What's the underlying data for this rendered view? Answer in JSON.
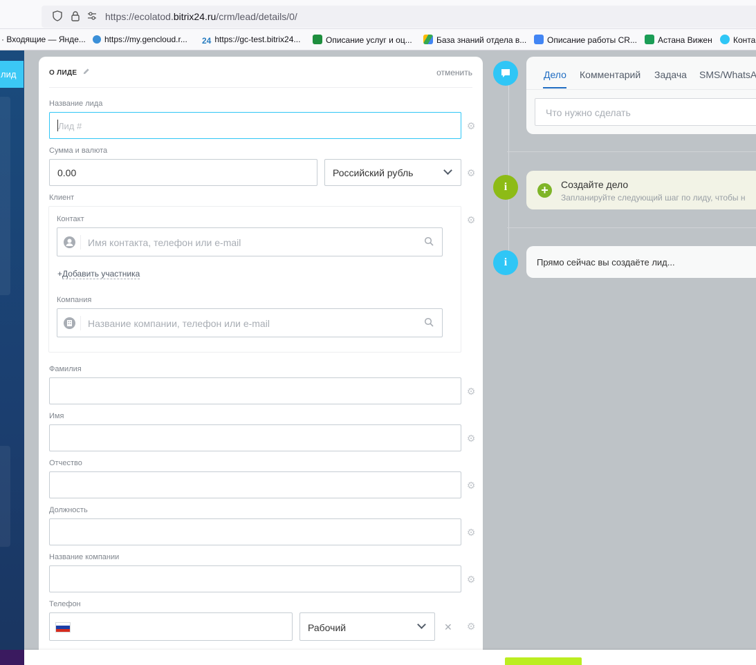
{
  "browser": {
    "url_prefix": "https://ecolatod.",
    "url_domain": "bitrix24.ru",
    "url_path": "/crm/lead/details/0/",
    "bookmarks": [
      {
        "label": "· Входящие — Яндe..."
      },
      {
        "label": "https://my.gencloud.r..."
      },
      {
        "label": "https://gc-test.bitrix24..."
      },
      {
        "label": "Описание услуг и оц..."
      },
      {
        "label": "База знаний отдела в..."
      },
      {
        "label": "Описание работы CR..."
      },
      {
        "label": "Астана Вижен"
      },
      {
        "label": "Конта"
      }
    ]
  },
  "sidebar": {
    "lead_button": "лид"
  },
  "form": {
    "section_title": "О ЛИДЕ",
    "cancel_label": "отменить",
    "lead_name": {
      "label": "Название лида",
      "placeholder": "Лид #",
      "value": ""
    },
    "amount": {
      "label": "Сумма и валюта",
      "value": "0.00",
      "currency": "Российский рубль"
    },
    "client": {
      "label": "Клиент",
      "contact_label": "Контакт",
      "contact_placeholder": "Имя контакта, телефон или e-mail",
      "add_participant": "Добавить участника",
      "company_label": "Компания",
      "company_placeholder": "Название компании, телефон или e-mail"
    },
    "last_name": {
      "label": "Фамилия",
      "value": ""
    },
    "first_name": {
      "label": "Имя",
      "value": ""
    },
    "middle_name": {
      "label": "Отчество",
      "value": ""
    },
    "position": {
      "label": "Должность",
      "value": ""
    },
    "company_name": {
      "label": "Название компании",
      "value": ""
    },
    "phone": {
      "label": "Телефон",
      "value": "",
      "type": "Рабочий"
    }
  },
  "timeline": {
    "tabs": [
      "Дело",
      "Комментарий",
      "Задача",
      "SMS/WhatsAp"
    ],
    "active_tab": "Дело",
    "todo_placeholder": "Что нужно сделать",
    "create_title": "Создайте дело",
    "create_subtitle": "Запланируйте следующий шаг по лиду, чтобы н",
    "now_text": "Прямо сейчас вы создаёте лид..."
  },
  "colors": {
    "accent": "#2fc6f6",
    "tab_active": "#1f6dc2",
    "save_button": "#bbed21",
    "rail": "#1a4b7d"
  }
}
